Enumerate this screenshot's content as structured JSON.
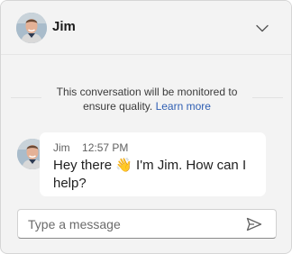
{
  "header": {
    "agent_name": "Jim",
    "avatar_icon": "person-photo-icon",
    "collapse_icon": "chevron-down-icon"
  },
  "notice": {
    "text": "This conversation will be monitored to ensure quality.",
    "link_label": "Learn more"
  },
  "messages": [
    {
      "sender": "Jim",
      "time": "12:57 PM",
      "text_before": "Hey there ",
      "emoji": "👋",
      "text_after": " I'm Jim. How can I help?"
    }
  ],
  "composer": {
    "placeholder": "Type a message",
    "value": "",
    "send_icon": "send-icon"
  },
  "colors": {
    "background": "#f3f3f3",
    "bubble": "#ffffff",
    "link": "#2f5fb3"
  }
}
